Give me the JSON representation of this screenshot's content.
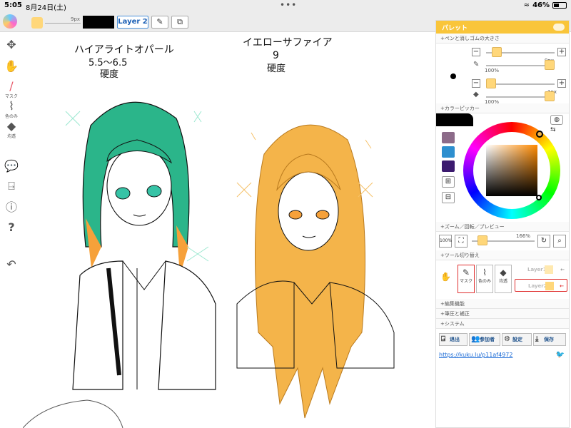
{
  "status": {
    "time": "5:05",
    "date": "8月24日(土)",
    "battery": "46%",
    "battery_level": 0.46
  },
  "toolbar": {
    "brush_size": "9px",
    "layer_label": "Layer 2"
  },
  "canvas": {
    "left_title": "ハイアライトオパール",
    "left_hardness": "5.5〜6.5",
    "left_word": "硬度",
    "right_title": "イエローサファイア",
    "right_hardness": "9",
    "right_word": "硬度"
  },
  "left_tools": {
    "mask_label": "マスク",
    "color_label": "色のみ",
    "uniform_label": "均透"
  },
  "palette": {
    "title": "パレット",
    "sections": {
      "pen_eraser": "+ペンと消しゴムの大きさ",
      "color_picker": "+カラーピッカー",
      "zoom": "+ズーム／回転／プレビュー",
      "tool_switch": "+ツール切り替え",
      "edit": "+編集機能",
      "pressure": "+筆圧と補正",
      "system": "+システム"
    },
    "pen": {
      "size": "9px",
      "opacity": "100%"
    },
    "eraser": {
      "size": "1px",
      "opacity": "100%"
    },
    "zoom": {
      "button": "100%",
      "value": "166%"
    },
    "tools": {
      "mask": "マスク",
      "color_only": "色のみ",
      "uniform": "均透"
    },
    "layers": [
      "Layer1",
      "Layer2"
    ],
    "footer": {
      "exit": "退出",
      "participants": "参加者",
      "settings": "設定",
      "save": "保存"
    },
    "link": "https://kuku.lu/p11af4972",
    "colors": {
      "swatch1": "#8c6b89",
      "swatch2": "#2d8fcf",
      "swatch3": "#3b1a6e",
      "accent": "#f9c53a"
    }
  }
}
